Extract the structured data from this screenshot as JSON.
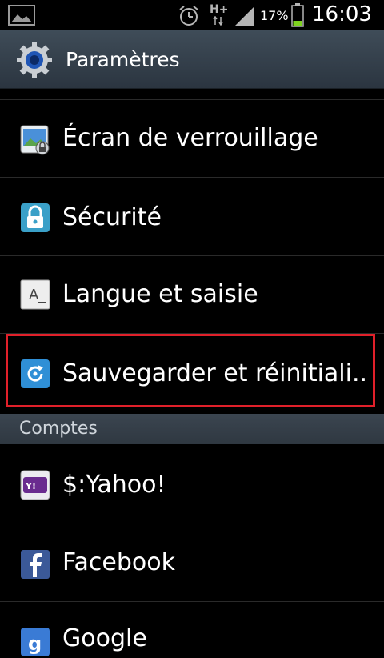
{
  "status_bar": {
    "battery_percent": "17%",
    "network_label": "H+",
    "time": "16:03"
  },
  "header": {
    "title": "Paramètres"
  },
  "items": [
    {
      "label": "Écran de verrouillage",
      "icon": "lock-screen-icon"
    },
    {
      "label": "Sécurité",
      "icon": "lock-icon"
    },
    {
      "label": "Langue et saisie",
      "icon": "keyboard-icon"
    },
    {
      "label": "Sauvegarder et réinitiali..",
      "icon": "backup-reset-icon"
    }
  ],
  "section": {
    "label": "Comptes"
  },
  "accounts": [
    {
      "label": "$:Yahoo!",
      "icon": "yahoo-icon"
    },
    {
      "label": "Facebook",
      "icon": "facebook-icon"
    },
    {
      "label": "Google",
      "icon": "google-icon"
    }
  ],
  "colors": {
    "highlight": "#e1202a",
    "header_bg": "#3f4c58"
  }
}
